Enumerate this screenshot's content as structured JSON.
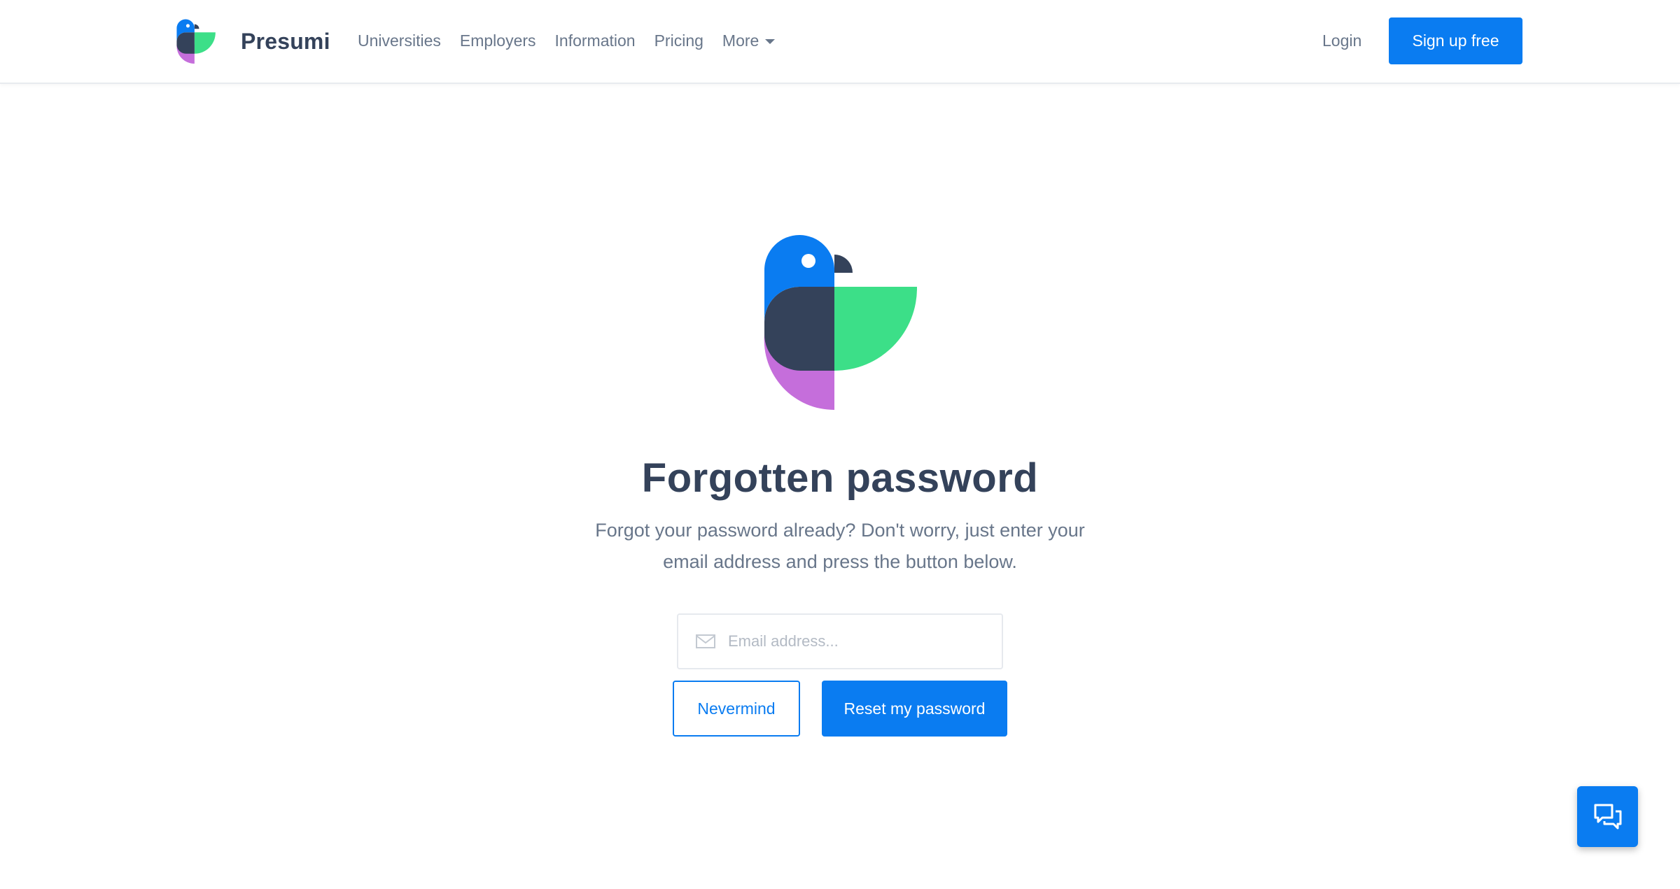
{
  "header": {
    "brand_name": "Presumi",
    "nav": [
      {
        "label": "Universities"
      },
      {
        "label": "Employers"
      },
      {
        "label": "Information"
      },
      {
        "label": "Pricing"
      },
      {
        "label": "More"
      }
    ],
    "login_label": "Login",
    "signup_label": "Sign up free"
  },
  "main": {
    "title": "Forgotten password",
    "subtitle": "Forgot your password already? Don't worry, just enter your email address and press the button below.",
    "email": {
      "placeholder": "Email address...",
      "value": "",
      "icon": "envelope-icon"
    },
    "nevermind_label": "Nevermind",
    "reset_label": "Reset my password"
  },
  "chat": {
    "icon": "chat-bubbles-icon"
  },
  "colors": {
    "accent": "#0a7cf1",
    "text_dark": "#34425a",
    "text_muted": "#68768a",
    "logo_blue": "#0a7cf1",
    "logo_navy": "#34425a",
    "logo_green": "#3cdf88",
    "logo_purple": "#c56edb"
  }
}
